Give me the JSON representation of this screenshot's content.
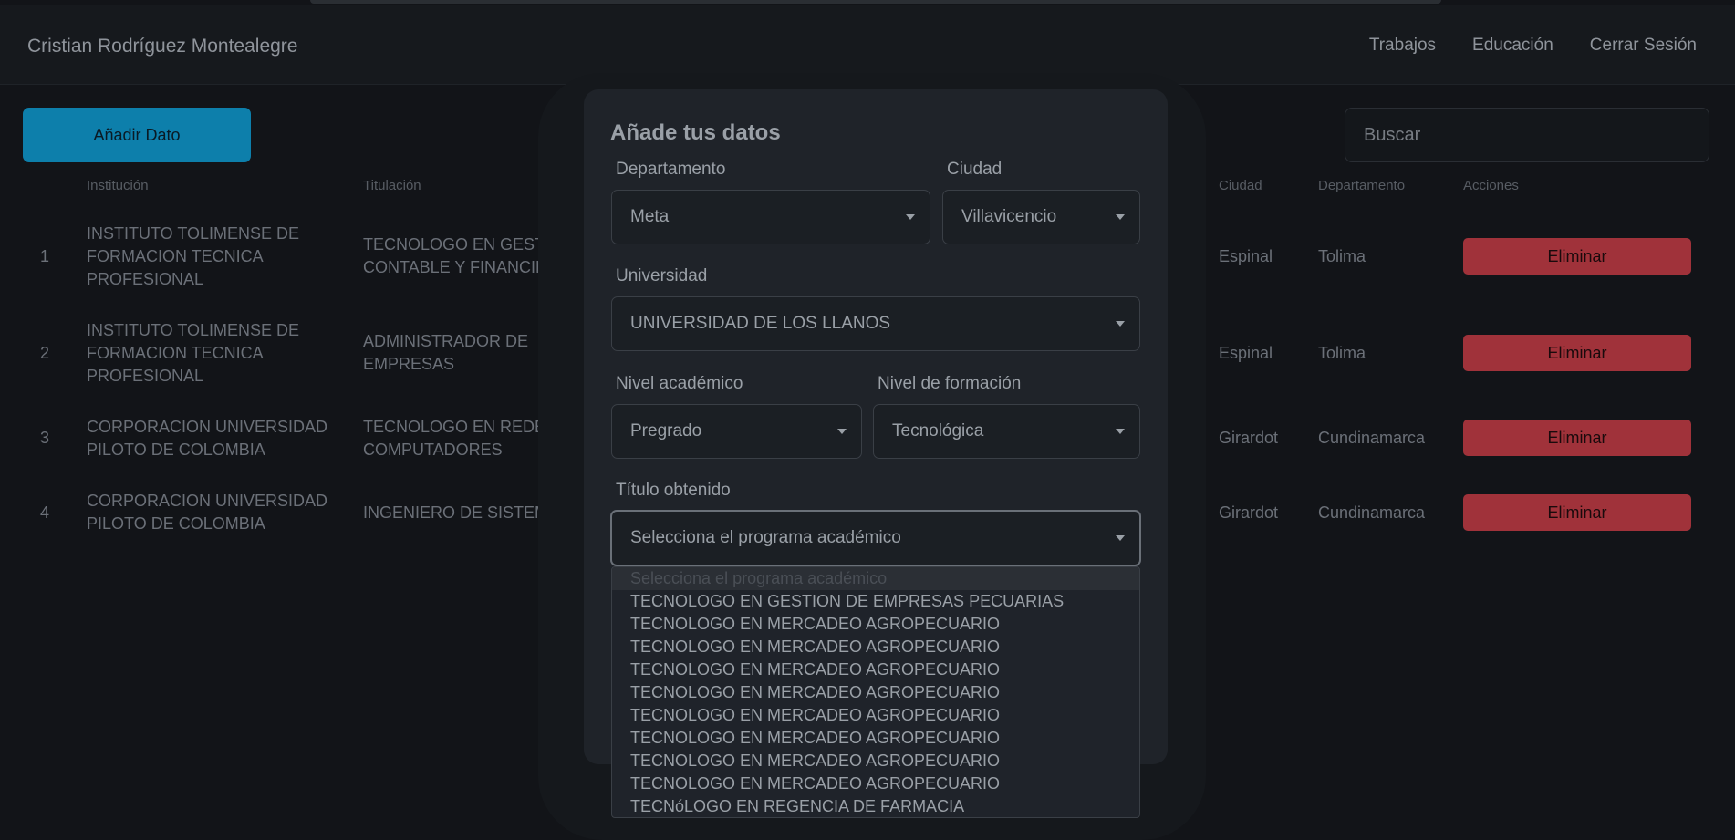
{
  "navbar": {
    "brand": "Cristian Rodríguez Montealegre",
    "links": [
      "Trabajos",
      "Educación",
      "Cerrar Sesión"
    ]
  },
  "toolbar": {
    "add_label": "Añadir Dato",
    "search_placeholder": "Buscar"
  },
  "table": {
    "headers": {
      "institucion": "Institución",
      "titulacion": "Titulación",
      "partial": "ón",
      "ciudad": "Ciudad",
      "departamento": "Departamento",
      "acciones": "Acciones"
    },
    "rows": [
      {
        "num": "1",
        "institucion": [
          "INSTITUTO TOLIMENSE DE",
          "FORMACION TECNICA",
          "PROFESIONAL"
        ],
        "titulacion": [
          "TECNOLOGO EN GESTIÓN",
          "CONTABLE Y FINANCIERA"
        ],
        "ciudad": "Espinal",
        "departamento": "Tolima",
        "action": "Eliminar"
      },
      {
        "num": "2",
        "institucion": [
          "INSTITUTO TOLIMENSE DE",
          "FORMACION TECNICA",
          "PROFESIONAL"
        ],
        "titulacion": [
          "ADMINISTRADOR DE",
          "EMPRESAS"
        ],
        "ciudad": "Espinal",
        "departamento": "Tolima",
        "action": "Eliminar"
      },
      {
        "num": "3",
        "institucion": [
          "CORPORACION UNIVERSIDAD",
          "PILOTO DE COLOMBIA"
        ],
        "titulacion": [
          "TECNOLOGO EN REDES DE",
          "COMPUTADORES"
        ],
        "ciudad": "Girardot",
        "departamento": "Cundinamarca",
        "action": "Eliminar"
      },
      {
        "num": "4",
        "institucion": [
          "CORPORACION UNIVERSIDAD",
          "PILOTO DE COLOMBIA"
        ],
        "titulacion": [
          "INGENIERO DE SISTEMAS"
        ],
        "ciudad": "Girardot",
        "departamento": "Cundinamarca",
        "action": "Eliminar"
      }
    ]
  },
  "modal": {
    "title": "Añade tus datos",
    "departamento": {
      "label": "Departamento",
      "value": "Meta"
    },
    "ciudad": {
      "label": "Ciudad",
      "value": "Villavicencio"
    },
    "universidad": {
      "label": "Universidad",
      "value": "UNIVERSIDAD DE LOS LLANOS"
    },
    "nivel_academico": {
      "label": "Nivel académico",
      "value": "Pregrado"
    },
    "nivel_formacion": {
      "label": "Nivel de formación",
      "value": "Tecnológica"
    },
    "titulo": {
      "label": "Título obtenido",
      "value": "Selecciona el programa académico"
    },
    "options": [
      "Selecciona el programa académico",
      "TECNOLOGO EN GESTION DE EMPRESAS PECUARIAS",
      "TECNOLOGO EN MERCADEO AGROPECUARIO",
      "TECNOLOGO EN MERCADEO AGROPECUARIO",
      "TECNOLOGO EN MERCADEO AGROPECUARIO",
      "TECNOLOGO EN MERCADEO AGROPECUARIO",
      "TECNOLOGO EN MERCADEO AGROPECUARIO",
      "TECNOLOGO EN MERCADEO AGROPECUARIO",
      "TECNOLOGO EN MERCADEO AGROPECUARIO",
      "TECNOLOGO EN MERCADEO AGROPECUARIO",
      "TECNóLOGO EN REGENCIA DE FARMACIA"
    ]
  }
}
